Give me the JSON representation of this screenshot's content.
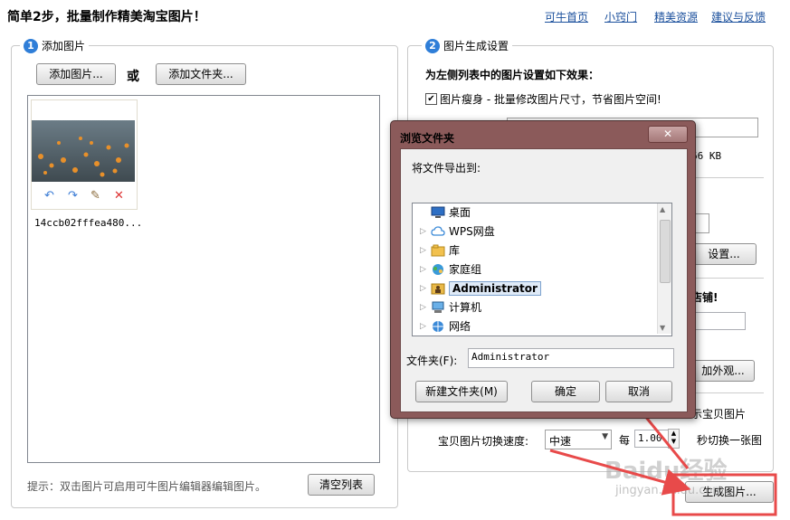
{
  "header": {
    "title": "简单2步，批量制作精美淘宝图片！",
    "links": [
      "可牛首页",
      "小窍门",
      "精美资源",
      "建议与反馈"
    ]
  },
  "step1": {
    "number": "1",
    "label": "添加图片",
    "add_image_button": "添加图片...",
    "or_text": "或",
    "add_folder_button": "添加文件夹...",
    "image_filename": "14ccb02fffea480...",
    "hint": "提示：双击图片可启用可牛图片编辑器编辑图片。",
    "clear_button": "清空列表"
  },
  "step2": {
    "number": "2",
    "label": "图片生成设置",
    "heading": "为左侧列表中的图片设置如下效果：",
    "slim_checkbox_label": "图片瘦身 - 批量修改图片尺寸，节省图片空间!",
    "size_fragment": "66 KB",
    "settings_button_fragment": "设置...",
    "store_fragment": "店铺!",
    "appearance_button_fragment": "加外观...",
    "show_item_fragment": "示宝贝图片",
    "speed_label": "宝贝图片切换速度:",
    "speed_value": "中速",
    "per_label": "每",
    "per_value": "1.00",
    "per_suffix": "秒切换一张图",
    "generate_button": "生成图片..."
  },
  "dialog": {
    "title": "浏览文件夹",
    "close_symbol": "✕",
    "prompt": "将文件导出到:",
    "tree": [
      {
        "label": "桌面",
        "icon": "desktop-icon",
        "expandable": false
      },
      {
        "label": "WPS网盘",
        "icon": "cloud-icon",
        "expandable": true
      },
      {
        "label": "库",
        "icon": "library-icon",
        "expandable": true
      },
      {
        "label": "家庭组",
        "icon": "homegroup-icon",
        "expandable": true
      },
      {
        "label": "Administrator",
        "icon": "user-folder-icon",
        "expandable": true,
        "selected": true
      },
      {
        "label": "计算机",
        "icon": "computer-icon",
        "expandable": true
      },
      {
        "label": "网络",
        "icon": "network-icon",
        "expandable": true
      }
    ],
    "folder_label": "文件夹(F):",
    "folder_value": "Administrator",
    "new_folder_button": "新建文件夹(M)",
    "ok_button": "确定",
    "cancel_button": "取消"
  },
  "watermark": {
    "brand": "Baidu经验",
    "url": "jingyan.baidu.com"
  },
  "colors": {
    "link": "#1a4f9c",
    "step_badge": "#2f7ed8",
    "dialog_frame": "#8b5a5a",
    "annotation_red": "#e84a4a"
  }
}
